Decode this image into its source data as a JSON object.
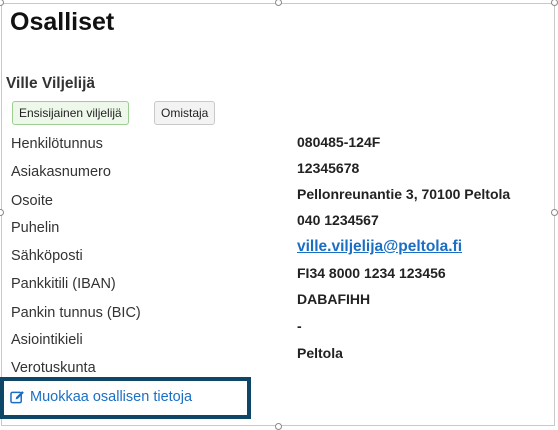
{
  "section": {
    "title": "Osalliset"
  },
  "person": {
    "name": "Ville Viljelijä",
    "badges": [
      "Ensisijainen viljelijä",
      "Omistaja"
    ]
  },
  "fields": [
    {
      "label": "Henkilötunnus",
      "value": "080485-124F"
    },
    {
      "label": "Asiakasnumero",
      "value": "12345678"
    },
    {
      "label": "Osoite",
      "value": "Pellonreunantie 3, 70100 Peltola"
    },
    {
      "label": "Puhelin",
      "value": "040 1234567"
    },
    {
      "label": "Sähköposti",
      "value": "ville.viljelija@peltola.fi"
    },
    {
      "label": "Pankkitili (IBAN)",
      "value": "FI34 8000 1234 123456"
    },
    {
      "label": "Pankin tunnus (BIC)",
      "value": "DABAFIHH"
    },
    {
      "label": "Asiointikieli",
      "value": "-"
    },
    {
      "label": "Verotuskunta",
      "value": "Peltola"
    }
  ],
  "actions": {
    "edit_label": "Muokkaa osallisen tietoja",
    "edit_icon": "edit-icon"
  },
  "colors": {
    "link": "#1a6fc4",
    "highlight_border": "#0e4668",
    "badge_primary_bg": "#eef8ea",
    "badge_primary_border": "#9ccf91"
  }
}
